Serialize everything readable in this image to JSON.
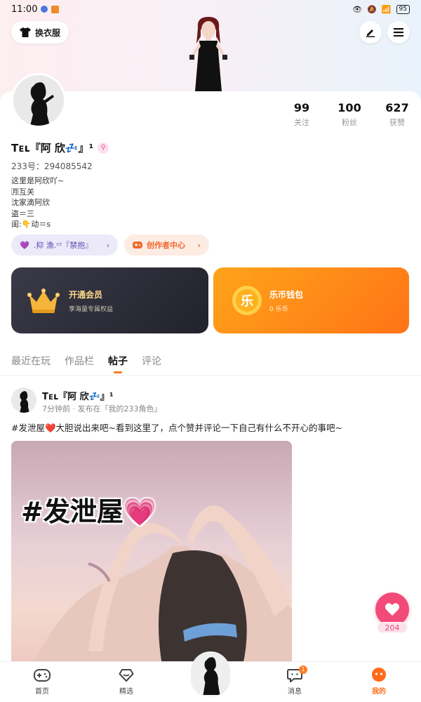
{
  "status": {
    "time": "11:00",
    "battery": "95"
  },
  "header": {
    "outfit_label": "换衣服"
  },
  "stats": [
    {
      "num": "99",
      "label": "关注"
    },
    {
      "num": "100",
      "label": "粉丝"
    },
    {
      "num": "627",
      "label": "获赞"
    }
  ],
  "profile": {
    "name": "Tᴇʟ『阿 欣💤』¹",
    "uid": "233号：294085542",
    "bio": [
      "这里是阿欣吖~",
      "🈷互关",
      "沈家滴阿欣",
      "盗＝三",
      "闺:👇动＝s"
    ]
  },
  "chips": {
    "family": ".抑 漁.ᶻᶻ『禁抱』",
    "creator": "创作者中心"
  },
  "vip": {
    "title": "开通会员",
    "subtitle": "享海量专属权益"
  },
  "wallet": {
    "title": "乐币钱包",
    "subtitle": "0 乐币",
    "coin_glyph": "乐"
  },
  "tabs": [
    "最近在玩",
    "作品栏",
    "帖子",
    "评论"
  ],
  "post": {
    "author": "Tᴇʟ『阿 欣💤』¹",
    "meta": "7分钟前 · 发布在「我的233角色」",
    "text": "#发泄屋❤️大胆说出来吧~看到这里了，点个赞并评论一下自己有什么不开心的事吧~",
    "image_caption": "#发泄屋💗"
  },
  "like": {
    "count": "204"
  },
  "nav": {
    "items": [
      {
        "label": "首页"
      },
      {
        "label": "精选"
      },
      {
        "label": ""
      },
      {
        "label": "消息"
      },
      {
        "label": "我的"
      }
    ],
    "message_badge": "1"
  },
  "colors": {
    "accent": "#ff7a21",
    "like": "#f24b7a",
    "vip_bg": "#2a2a36",
    "wallet_bg": "#ff8c1a"
  }
}
